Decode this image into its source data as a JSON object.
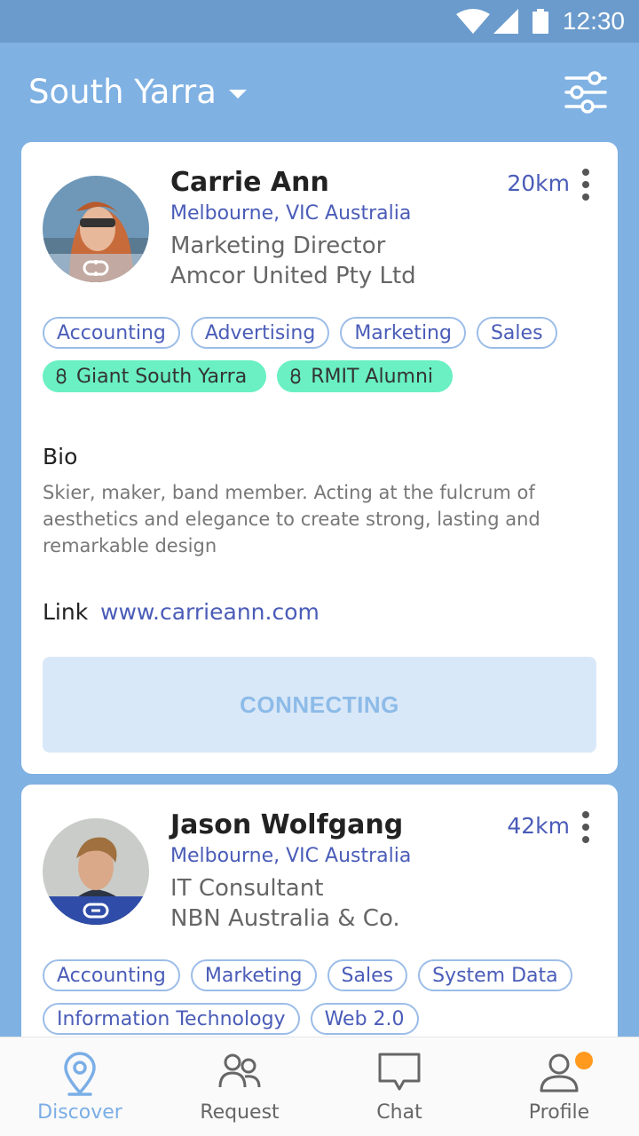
{
  "status_bar": {
    "time": "12:30"
  },
  "header": {
    "location": "South Yarra"
  },
  "profiles": [
    {
      "name": "Carrie Ann",
      "location": "Melbourne, VIC Australia",
      "title": "Marketing Director",
      "company": "Amcor United Pty Ltd",
      "distance": "20km",
      "tags": [
        "Accounting",
        "Advertising",
        "Marketing",
        "Sales"
      ],
      "groups": [
        "Giant South Yarra",
        "RMIT Alumni"
      ],
      "bio_label": "Bio",
      "bio": "Skier, maker, band member. Acting at the fulcrum of aesthetics and elegance to create strong, lasting and remarkable design",
      "link_label": "Link",
      "link": "www.carrieann.com",
      "action": "CONNECTING"
    },
    {
      "name": "Jason Wolfgang",
      "location": "Melbourne, VIC Australia",
      "title": "IT Consultant",
      "company": "NBN Australia & Co.",
      "distance": "42km",
      "tags": [
        "Accounting",
        "Marketing",
        "Sales",
        "System Data",
        "Information Technology",
        "Web 2.0"
      ]
    }
  ],
  "nav": {
    "discover": "Discover",
    "request": "Request",
    "chat": "Chat",
    "profile": "Profile"
  },
  "colors": {
    "header_bg": "#7fb1e3",
    "status_bg": "#6a9bcc",
    "accent_text": "#4a5cb8",
    "group_tag": "#6af0c2",
    "notification": "#ff9a1f"
  }
}
